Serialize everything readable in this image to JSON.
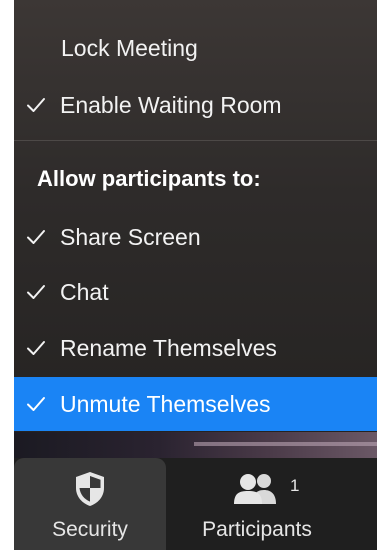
{
  "menu": {
    "items": [
      {
        "label": "Lock Meeting",
        "checked": false
      },
      {
        "label": "Enable Waiting Room",
        "checked": true
      }
    ],
    "section_header": "Allow participants to:",
    "permissions": [
      {
        "label": "Share Screen",
        "checked": true,
        "highlighted": false
      },
      {
        "label": "Chat",
        "checked": true,
        "highlighted": false
      },
      {
        "label": "Rename Themselves",
        "checked": true,
        "highlighted": false
      },
      {
        "label": "Unmute Themselves",
        "checked": true,
        "highlighted": true
      }
    ],
    "highlight_color": "#1a84f5"
  },
  "toolbar": {
    "security": {
      "label": "Security",
      "icon": "shield-icon"
    },
    "participants": {
      "label": "Participants",
      "icon": "people-icon",
      "count": "1"
    }
  }
}
